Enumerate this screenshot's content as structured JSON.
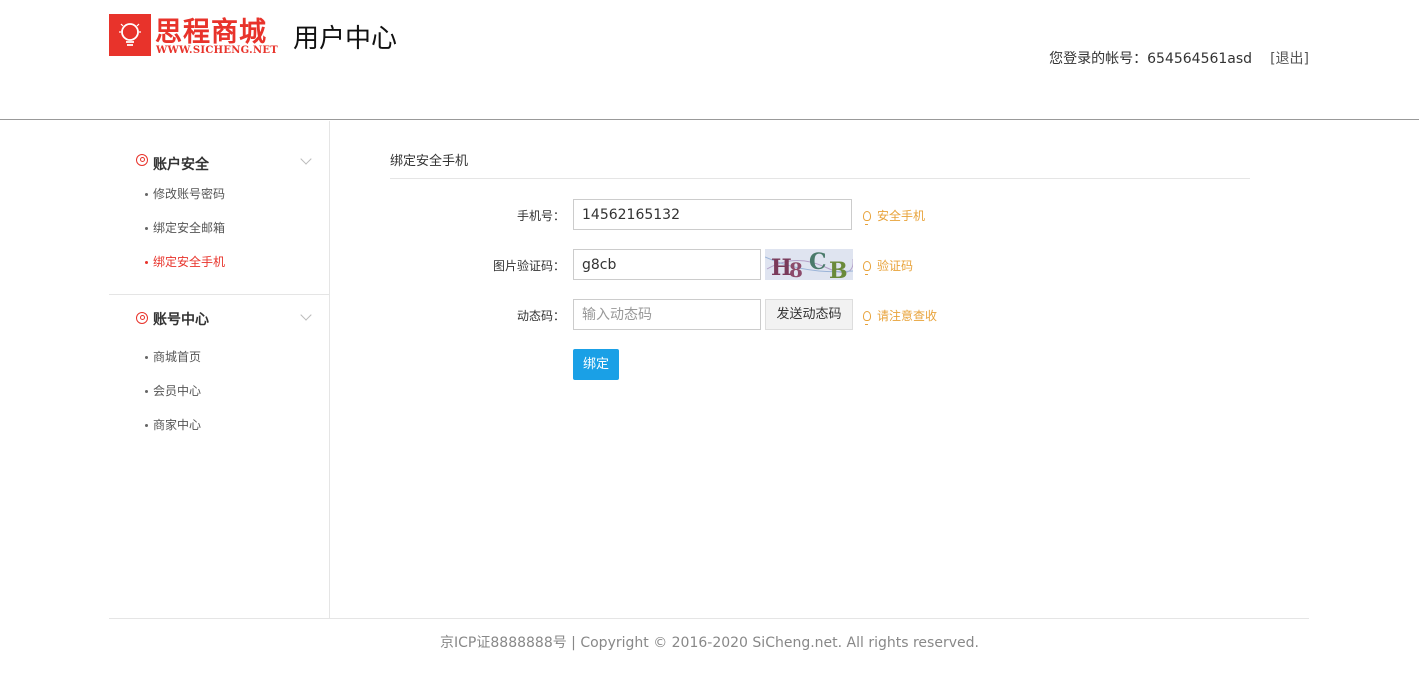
{
  "header": {
    "logo_name": "思程商城",
    "logo_url": "WWW.SICHENG.NET",
    "site_title": "用户中心",
    "account_label": "您登录的帐号：654564561asd",
    "logout_label": "[退出]"
  },
  "sidebar": {
    "groups": [
      {
        "title": "账户安全",
        "items": [
          {
            "label": "修改账号密码",
            "active": false
          },
          {
            "label": "绑定安全邮箱",
            "active": false
          },
          {
            "label": "绑定安全手机",
            "active": true
          }
        ]
      },
      {
        "title": "账号中心",
        "items": [
          {
            "label": "商城首页",
            "active": false
          },
          {
            "label": "会员中心",
            "active": false
          },
          {
            "label": "商家中心",
            "active": false
          }
        ]
      }
    ]
  },
  "form": {
    "title": "绑定安全手机",
    "phone": {
      "label": "手机号：",
      "value": "14562165132",
      "hint": "安全手机"
    },
    "captcha": {
      "label": "图片验证码：",
      "value": "g8cb",
      "image_text": "H8CB",
      "hint": "验证码"
    },
    "dynamic": {
      "label": "动态码：",
      "placeholder": "输入动态码",
      "send_label": "发送动态码",
      "hint": "请注意查收"
    },
    "submit_label": "绑定"
  },
  "footer": {
    "text": "京ICP证8888888号  |  Copyright © 2016-2020 SiCheng.net. All rights reserved."
  },
  "colors": {
    "brand_red": "#e8332b",
    "hint_orange": "#e8a33b",
    "button_blue": "#1aa0e6"
  }
}
